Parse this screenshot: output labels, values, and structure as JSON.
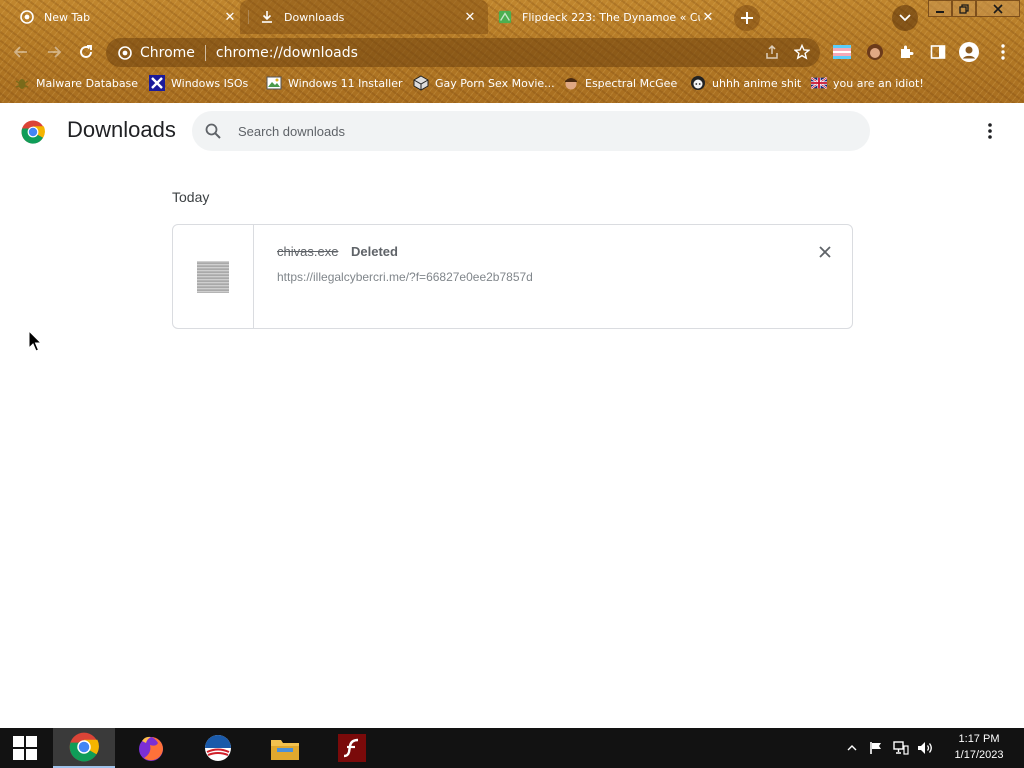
{
  "tabs": [
    {
      "title": "New Tab",
      "active": false
    },
    {
      "title": "Downloads",
      "active": true
    },
    {
      "title": "Flipdeck 223: The Dynamoe « Cu",
      "active": false
    }
  ],
  "omnibox": {
    "site_label": "Chrome",
    "url": "chrome://downloads"
  },
  "bookmarks": [
    {
      "label": "Malware Database"
    },
    {
      "label": "Windows ISOs"
    },
    {
      "label": "Windows 11 Installer"
    },
    {
      "label": "Gay Porn Sex Movie..."
    },
    {
      "label": "Espectral McGee"
    },
    {
      "label": "uhhh anime shit"
    },
    {
      "label": "you are an idiot!"
    }
  ],
  "page": {
    "title": "Downloads",
    "search_placeholder": "Search downloads",
    "date_header": "Today"
  },
  "downloads": [
    {
      "filename": "chivas.exe",
      "status": "Deleted",
      "url": "https://illegalcybercri.me/?f=66827e0ee2b7857d"
    }
  ],
  "taskbar": {
    "apps": [
      "chrome-icon",
      "firefox-icon",
      "obama-icon",
      "file-explorer-icon",
      "flash-icon"
    ],
    "time": "1:17 PM",
    "date": "1/17/2023"
  },
  "colors": {
    "accent": "#1a73e8",
    "frame": "#b47a26",
    "taskbar": "#121212"
  }
}
